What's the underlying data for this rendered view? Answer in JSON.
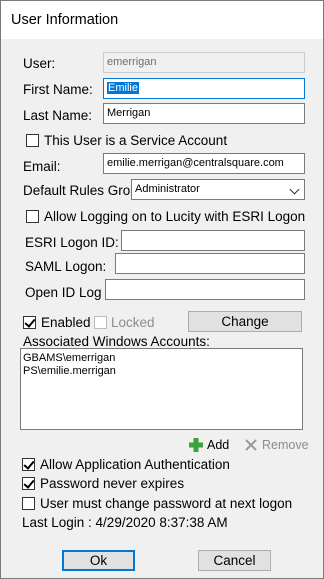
{
  "window": {
    "title": "User Information"
  },
  "labels": {
    "user": "User:",
    "first_name": "First Name:",
    "last_name": "Last Name:",
    "email": "Email:",
    "default_rules_group": "Default Rules Gro",
    "esri_logon_id": "ESRI Logon ID:",
    "saml_logon": "SAML Logon:",
    "open_id_logon": "Open ID Log",
    "associated_windows_accounts": "Associated Windows Accounts:",
    "last_login": "Last Login : 4/29/2020 8:37:38 AM"
  },
  "fields": {
    "user": "emerrigan",
    "first_name": "Emilie",
    "last_name": "Merrigan",
    "email": "emilie.merrigan@centralsquare.com",
    "default_rules_group": "Administrator",
    "esri_logon_id": "",
    "saml_logon": "",
    "open_id_logon": ""
  },
  "checkboxes": {
    "service_account": {
      "label": "This User is a Service Account",
      "checked": false
    },
    "esri_logon": {
      "label": "Allow Logging on to Lucity with ESRI Logon",
      "checked": false
    },
    "enabled": {
      "label": "Enabled",
      "checked": true
    },
    "locked": {
      "label": "Locked",
      "checked": false
    },
    "allow_app_auth": {
      "label": "Allow Application Authentication",
      "checked": true
    },
    "password_never_expires": {
      "label": "Password never expires",
      "checked": true
    },
    "must_change_password": {
      "label": "User must change password at next logon",
      "checked": false
    }
  },
  "buttons": {
    "change": "Change",
    "add": "Add",
    "remove": "Remove",
    "ok": "Ok",
    "cancel": "Cancel"
  },
  "windows_accounts": [
    "GBAMS\\emerrigan",
    "PS\\emilie.merrigan"
  ],
  "colors": {
    "accent": "#0078d7",
    "add_icon": "#3aa33a",
    "remove_icon": "#9a9a9a"
  }
}
